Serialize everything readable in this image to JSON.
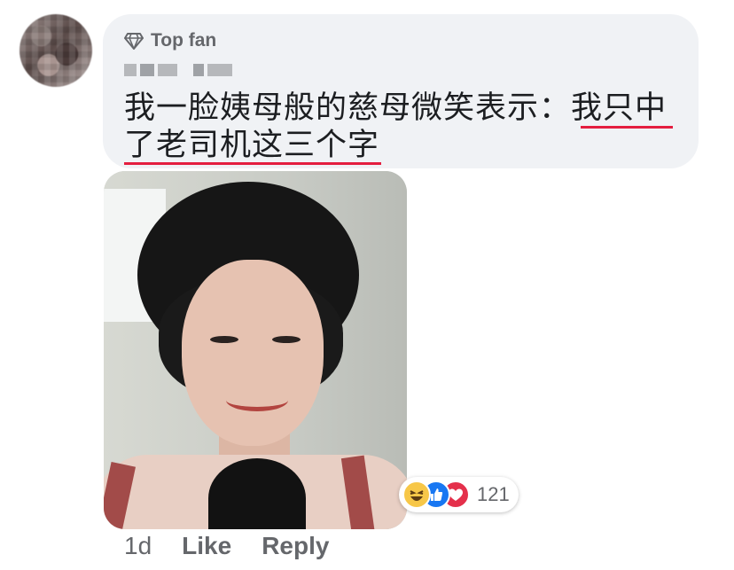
{
  "comment": {
    "badge": "Top fan",
    "text_line1": "我一脸姨母般的慈母微笑表示：我只中",
    "text_line2": "了老司机这三个字"
  },
  "reactions": {
    "types": [
      "haha",
      "like",
      "love"
    ],
    "count": "121",
    "colors": {
      "haha": "#f7c748",
      "like": "#1877f2",
      "love": "#e4304b"
    }
  },
  "actions": {
    "timestamp": "1d",
    "like_label": "Like",
    "reply_label": "Reply"
  },
  "icons": {
    "badge": "diamond-icon"
  },
  "colors": {
    "bubble": "#f0f2f5",
    "underline": "#e41e3f",
    "muted_text": "#65676b"
  }
}
